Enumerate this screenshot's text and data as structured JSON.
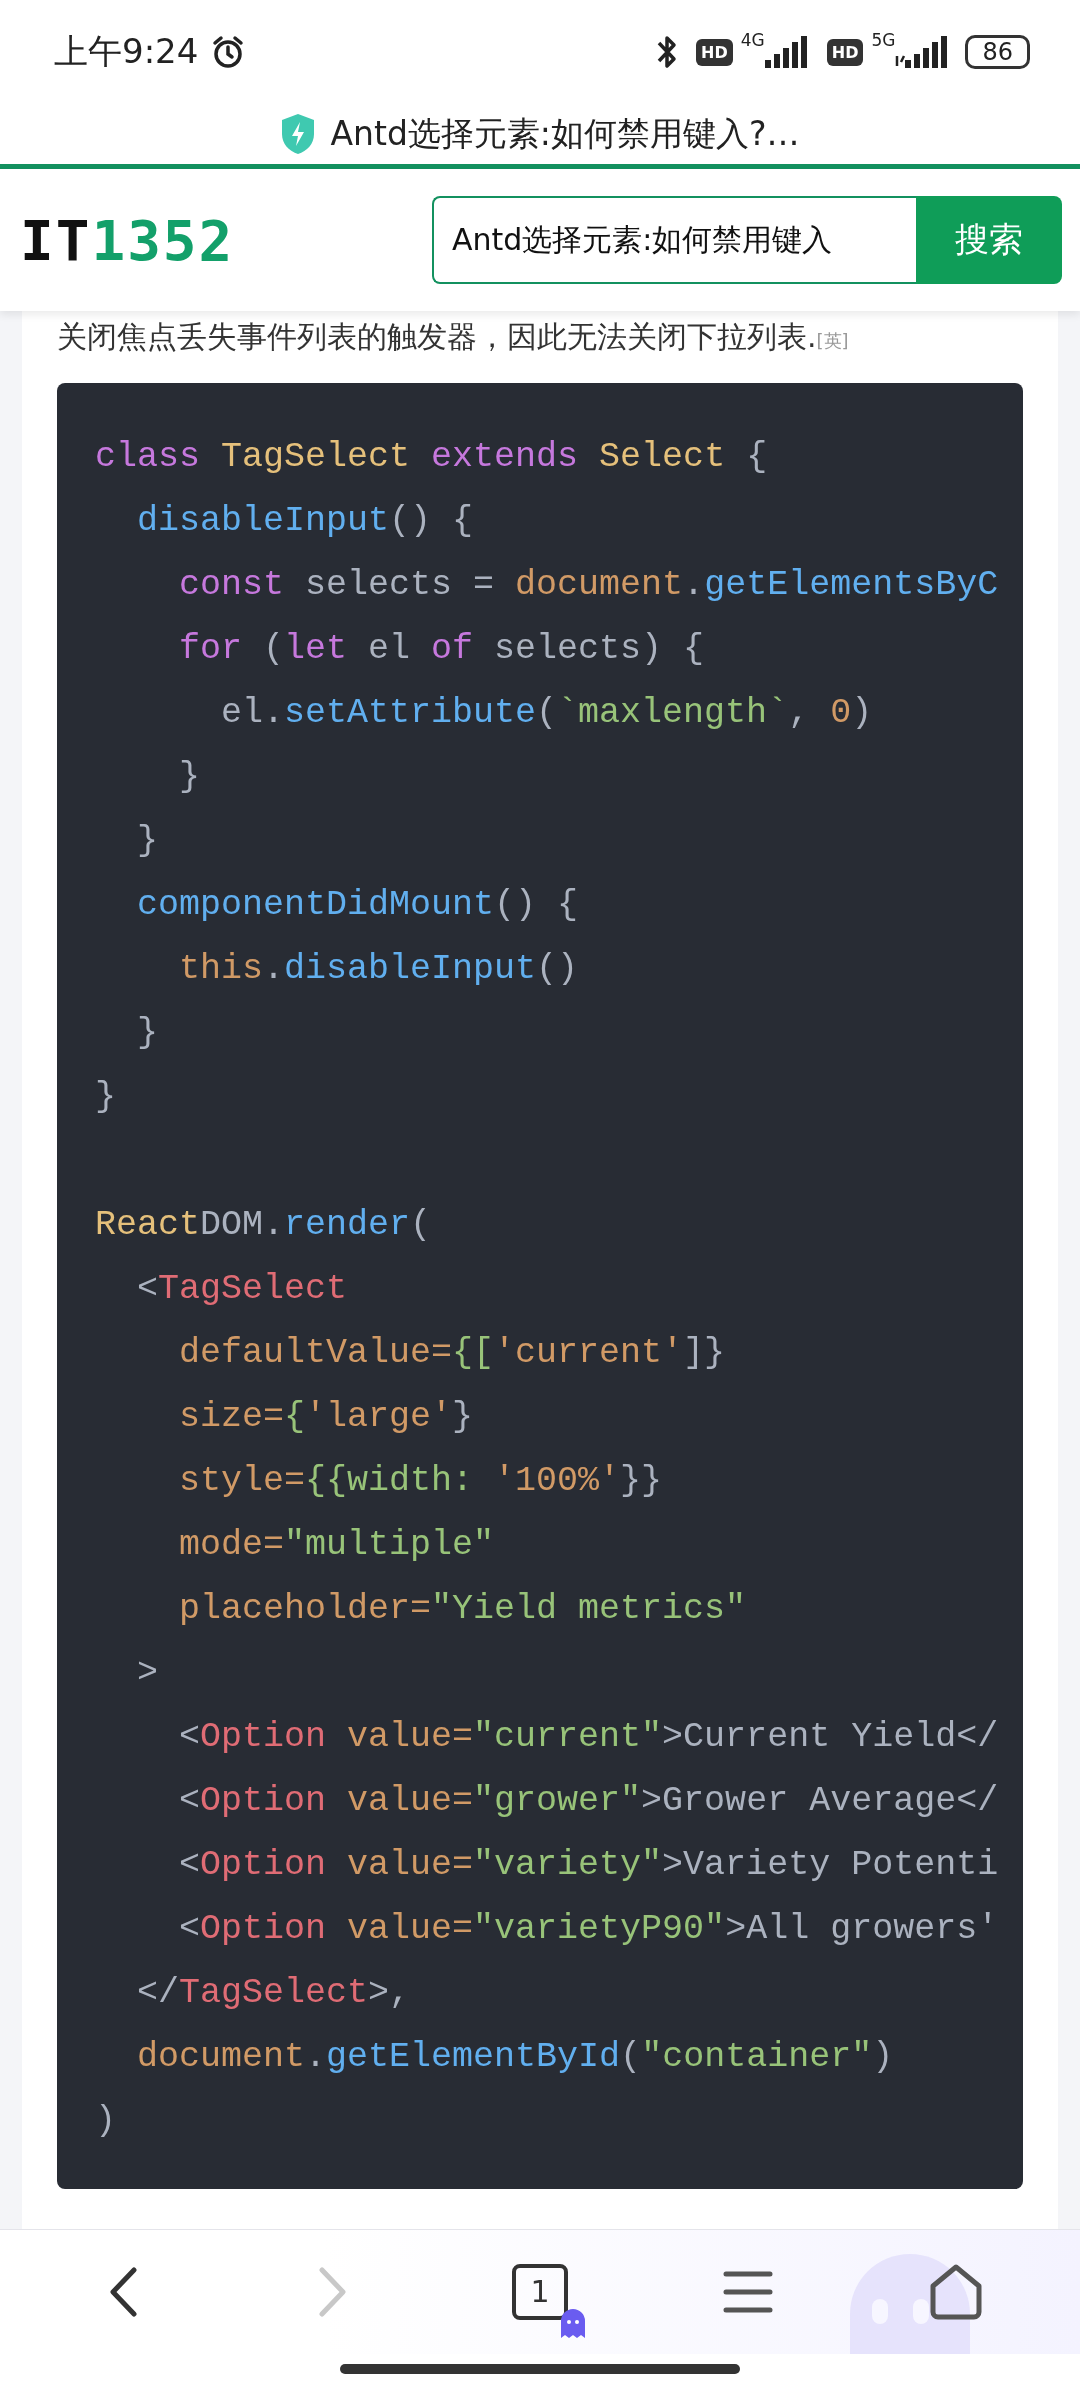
{
  "status_bar": {
    "time": "上午9:24",
    "hd_1": "HD",
    "network_1": "4G",
    "hd_2": "HD",
    "network_2": "5G",
    "battery": "86"
  },
  "tab_title": "Antd选择元素:如何禁用键入?…",
  "site": {
    "logo_prefix": "IT",
    "logo_number": "1352",
    "search_value": "Antd选择元素:如何禁用键入",
    "search_button": "搜索"
  },
  "article": {
    "text": "关闭焦点丢失事件列表的触发器，因此无法关闭下拉列表.",
    "translation_tag": "[英]"
  },
  "code": [
    {
      "kind": "code",
      "tokens": [
        {
          "kind": "kw",
          "text": "class "
        },
        {
          "kind": "cls",
          "text": "TagSelect "
        },
        {
          "kind": "kw",
          "text": "extends "
        },
        {
          "kind": "cls",
          "text": "Select "
        },
        {
          "kind": "plain",
          "text": "{"
        }
      ],
      "children": [
        {
          "kind": "code",
          "tokens": [
            {
              "kind": "fn",
              "text": "disableInput"
            },
            {
              "kind": "plain",
              "text": "() {"
            }
          ],
          "children": [
            {
              "kind": "code",
              "tokens": [
                {
                  "kind": "kw",
                  "text": "const "
                },
                {
                  "kind": "plain",
                  "text": "selects = "
                },
                {
                  "kind": "num",
                  "text": "document"
                },
                {
                  "kind": "plain",
                  "text": "."
                },
                {
                  "kind": "fn",
                  "text": "getElementsByC"
                }
              ]
            },
            {
              "kind": "code",
              "tokens": [
                {
                  "kind": "kw",
                  "text": "for "
                },
                {
                  "kind": "plain",
                  "text": "("
                },
                {
                  "kind": "kw",
                  "text": "let "
                },
                {
                  "kind": "plain",
                  "text": "el "
                },
                {
                  "kind": "kw",
                  "text": "of "
                },
                {
                  "kind": "plain",
                  "text": "selects) {"
                }
              ],
              "children": [
                {
                  "kind": "code",
                  "tokens": [
                    {
                      "kind": "plain",
                      "text": "el."
                    },
                    {
                      "kind": "fn",
                      "text": "setAttribute"
                    },
                    {
                      "kind": "plain",
                      "text": "("
                    },
                    {
                      "kind": "str",
                      "text": "`maxlength`"
                    },
                    {
                      "kind": "plain",
                      "text": ", "
                    },
                    {
                      "kind": "num",
                      "text": "0"
                    },
                    {
                      "kind": "plain",
                      "text": ")"
                    }
                  ]
                }
              ]
            },
            {
              "kind": "code",
              "tokens": [
                {
                  "kind": "plain",
                  "text": "}"
                }
              ]
            }
          ]
        },
        {
          "kind": "code",
          "tokens": [
            {
              "kind": "plain",
              "text": "}"
            }
          ]
        },
        {
          "kind": "code",
          "tokens": [
            {
              "kind": "fn",
              "text": "componentDidMount"
            },
            {
              "kind": "plain",
              "text": "() {"
            }
          ],
          "children": [
            {
              "kind": "code",
              "tokens": [
                {
                  "kind": "num",
                  "text": "this"
                },
                {
                  "kind": "plain",
                  "text": "."
                },
                {
                  "kind": "fn",
                  "text": "disableInput"
                },
                {
                  "kind": "plain",
                  "text": "()"
                }
              ]
            }
          ]
        },
        {
          "kind": "code",
          "tokens": [
            {
              "kind": "plain",
              "text": "}"
            }
          ]
        }
      ]
    },
    {
      "kind": "code",
      "tokens": [
        {
          "kind": "plain",
          "text": "}"
        }
      ]
    },
    {
      "kind": "blank"
    },
    {
      "kind": "code",
      "tokens": [
        {
          "kind": "cls",
          "text": "React"
        },
        {
          "kind": "plain",
          "text": "DOM."
        },
        {
          "kind": "fn",
          "text": "render"
        },
        {
          "kind": "plain",
          "text": "("
        }
      ],
      "children": [
        {
          "kind": "code",
          "tokens": [
            {
              "kind": "plain",
              "text": "<"
            },
            {
              "kind": "tag",
              "text": "TagSelect"
            }
          ],
          "children": [
            {
              "kind": "code",
              "tokens": [
                {
                  "kind": "num",
                  "text": "defaultValue="
                },
                {
                  "kind": "str",
                  "text": "{["
                },
                {
                  "kind": "num",
                  "text": "'current'"
                },
                {
                  "kind": "plain",
                  "text": "]}"
                }
              ]
            },
            {
              "kind": "code",
              "tokens": [
                {
                  "kind": "num",
                  "text": "size="
                },
                {
                  "kind": "str",
                  "text": "{"
                },
                {
                  "kind": "num",
                  "text": "'large'"
                },
                {
                  "kind": "plain",
                  "text": "}"
                }
              ]
            },
            {
              "kind": "code",
              "tokens": [
                {
                  "kind": "num",
                  "text": "style="
                },
                {
                  "kind": "str",
                  "text": "{{width: "
                },
                {
                  "kind": "num",
                  "text": "'100%'"
                },
                {
                  "kind": "plain",
                  "text": "}}"
                }
              ]
            },
            {
              "kind": "code",
              "tokens": [
                {
                  "kind": "num",
                  "text": "mode="
                },
                {
                  "kind": "str",
                  "text": "\"multiple\""
                }
              ]
            },
            {
              "kind": "code",
              "tokens": [
                {
                  "kind": "num",
                  "text": "placeholder="
                },
                {
                  "kind": "str",
                  "text": "\"Yield metrics\""
                }
              ]
            }
          ]
        },
        {
          "kind": "code",
          "tokens": [
            {
              "kind": "plain",
              "text": ">"
            }
          ],
          "children": [
            {
              "kind": "code",
              "tokens": [
                {
                  "kind": "plain",
                  "text": "<"
                },
                {
                  "kind": "tag",
                  "text": "Option "
                },
                {
                  "kind": "num",
                  "text": "value="
                },
                {
                  "kind": "str",
                  "text": "\"current\""
                },
                {
                  "kind": "plain",
                  "text": ">Current Yield</"
                }
              ]
            },
            {
              "kind": "code",
              "tokens": [
                {
                  "kind": "plain",
                  "text": "<"
                },
                {
                  "kind": "tag",
                  "text": "Option "
                },
                {
                  "kind": "num",
                  "text": "value="
                },
                {
                  "kind": "str",
                  "text": "\"grower\""
                },
                {
                  "kind": "plain",
                  "text": ">Grower Average</"
                }
              ]
            },
            {
              "kind": "code",
              "tokens": [
                {
                  "kind": "plain",
                  "text": "<"
                },
                {
                  "kind": "tag",
                  "text": "Option "
                },
                {
                  "kind": "num",
                  "text": "value="
                },
                {
                  "kind": "str",
                  "text": "\"variety\""
                },
                {
                  "kind": "plain",
                  "text": ">Variety Potenti"
                }
              ]
            },
            {
              "kind": "code",
              "tokens": [
                {
                  "kind": "plain",
                  "text": "<"
                },
                {
                  "kind": "tag",
                  "text": "Option "
                },
                {
                  "kind": "num",
                  "text": "value="
                },
                {
                  "kind": "str",
                  "text": "\"varietyP90\""
                },
                {
                  "kind": "plain",
                  "text": ">All growers'"
                }
              ]
            }
          ]
        },
        {
          "kind": "code",
          "tokens": [
            {
              "kind": "plain",
              "text": "</"
            },
            {
              "kind": "tag",
              "text": "TagSelect"
            },
            {
              "kind": "plain",
              "text": ">,"
            }
          ]
        },
        {
          "kind": "code",
          "tokens": [
            {
              "kind": "num",
              "text": "document"
            },
            {
              "kind": "plain",
              "text": "."
            },
            {
              "kind": "fn",
              "text": "getElementById"
            },
            {
              "kind": "plain",
              "text": "("
            },
            {
              "kind": "str",
              "text": "\"container\""
            },
            {
              "kind": "plain",
              "text": ")"
            }
          ]
        }
      ]
    },
    {
      "kind": "code",
      "tokens": [
        {
          "kind": "plain",
          "text": ")"
        }
      ]
    }
  ],
  "bottom_nav": {
    "tab_count": "1",
    "items": [
      {
        "kind": "back",
        "disabled": false
      },
      {
        "kind": "forward",
        "disabled": true
      },
      {
        "kind": "tabs",
        "disabled": false
      },
      {
        "kind": "menu",
        "disabled": false
      },
      {
        "kind": "home",
        "disabled": false
      }
    ]
  }
}
